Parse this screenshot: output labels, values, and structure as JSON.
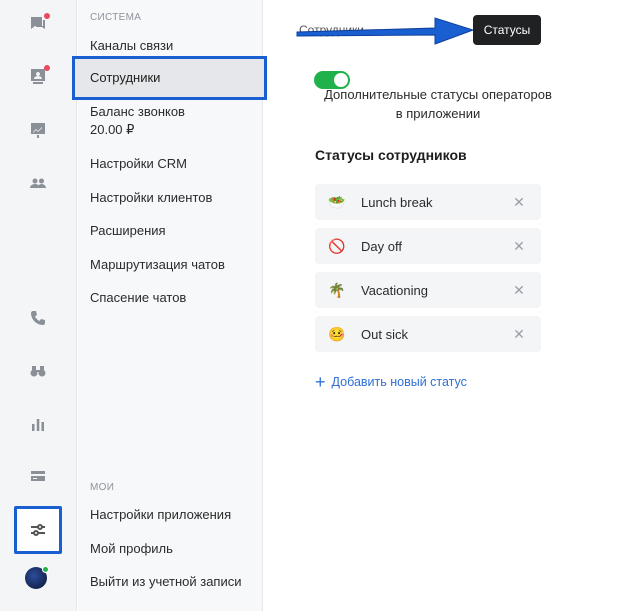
{
  "rail": {
    "icons": [
      {
        "name": "chats-icon",
        "badge": true
      },
      {
        "name": "contacts-icon",
        "badge": true
      },
      {
        "name": "analytics-board-icon",
        "badge": false
      },
      {
        "name": "team-icon",
        "badge": false
      },
      {
        "name": "phone-icon",
        "badge": false
      },
      {
        "name": "binoculars-icon",
        "badge": false
      },
      {
        "name": "bar-chart-icon",
        "badge": false
      },
      {
        "name": "billing-card-icon",
        "badge": false
      },
      {
        "name": "settings-sliders-icon",
        "badge": false
      }
    ]
  },
  "menu": {
    "section_system": "СИСТЕМА",
    "items": [
      "Каналы связи",
      "Сотрудники",
      "Баланс звонков",
      "Настройки CRM",
      "Настройки клиентов",
      "Расширения",
      "Маршрутизация чатов",
      "Спасение чатов"
    ],
    "balance_value": "20.00 ₽",
    "section_my": "МОИ",
    "my_items": [
      "Настройки приложения",
      "Мой профиль",
      "Выйти из учетной записи"
    ]
  },
  "main": {
    "breadcrumb": "Сотрудники",
    "tooltip": "Статусы",
    "toggle_on": true,
    "toggle_label": "Дополнительные статусы операторов в приложении",
    "section_title": "Статусы сотрудников",
    "statuses": [
      {
        "emoji": "🥗",
        "label": "Lunch break"
      },
      {
        "emoji": "🚫",
        "label": "Day off"
      },
      {
        "emoji": "🌴",
        "label": "Vacationing"
      },
      {
        "emoji": "🤒",
        "label": "Out sick"
      }
    ],
    "remove_glyph": "✕",
    "add_status": "Добавить новый статус",
    "add_glyph": "+"
  },
  "colors": {
    "accent": "#2f6fd6",
    "highlight_border": "#1a5fd1",
    "toggle_on": "#21b14b",
    "badge": "#e84a5f"
  }
}
